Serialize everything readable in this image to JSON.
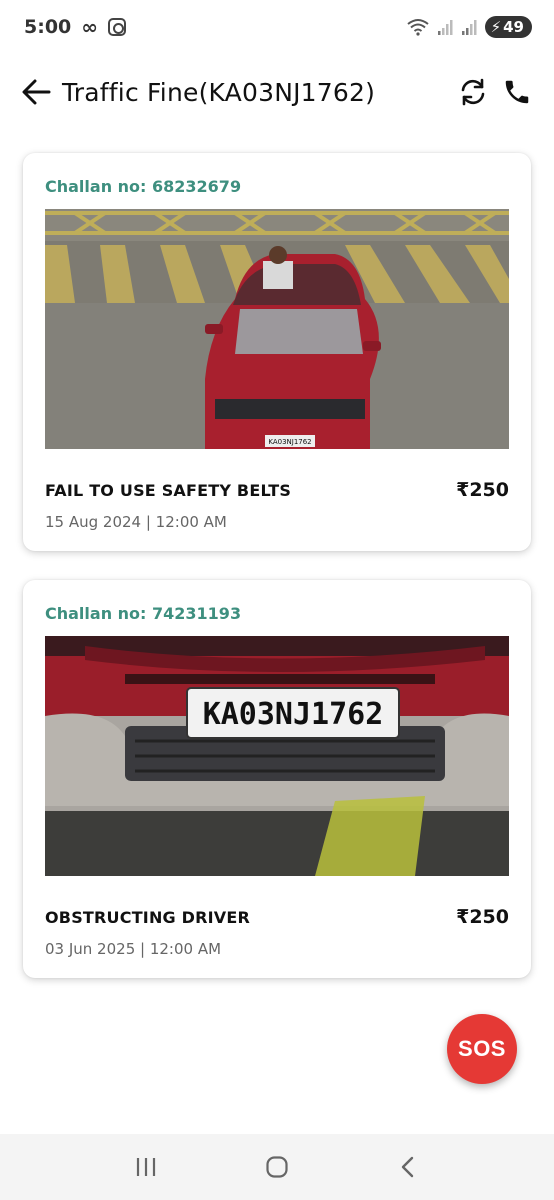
{
  "status_bar": {
    "time": "5:00",
    "battery": "49",
    "icons": [
      "infinity-icon",
      "instagram-icon",
      "wifi-icon",
      "signal-icon",
      "signal-icon",
      "battery-charging-icon"
    ]
  },
  "app_bar": {
    "title": "Traffic Fine(KA03NJ1762)",
    "icons": [
      "back-arrow-icon",
      "refresh-icon",
      "phone-icon"
    ]
  },
  "challans": [
    {
      "challan_label": "Challan no: 68232679",
      "violation": "FAIL TO USE SAFETY BELTS",
      "amount": "₹250",
      "datetime": "15 Aug 2024 | 12:00 AM",
      "photo_plate_text": "KA03NJ1762"
    },
    {
      "challan_label": "Challan no: 74231193",
      "violation": "OBSTRUCTING DRIVER",
      "amount": "₹250",
      "datetime": "03 Jun 2025 | 12:00 AM",
      "photo_plate_text": "KA03NJ1762"
    }
  ],
  "sos": {
    "label": "SOS"
  },
  "nav_bar": {
    "icons": [
      "recent-apps-icon",
      "home-icon",
      "back-icon"
    ]
  },
  "colors": {
    "accent": "#3e8f7f",
    "sos": "#e53935",
    "car": "#a8202e"
  }
}
